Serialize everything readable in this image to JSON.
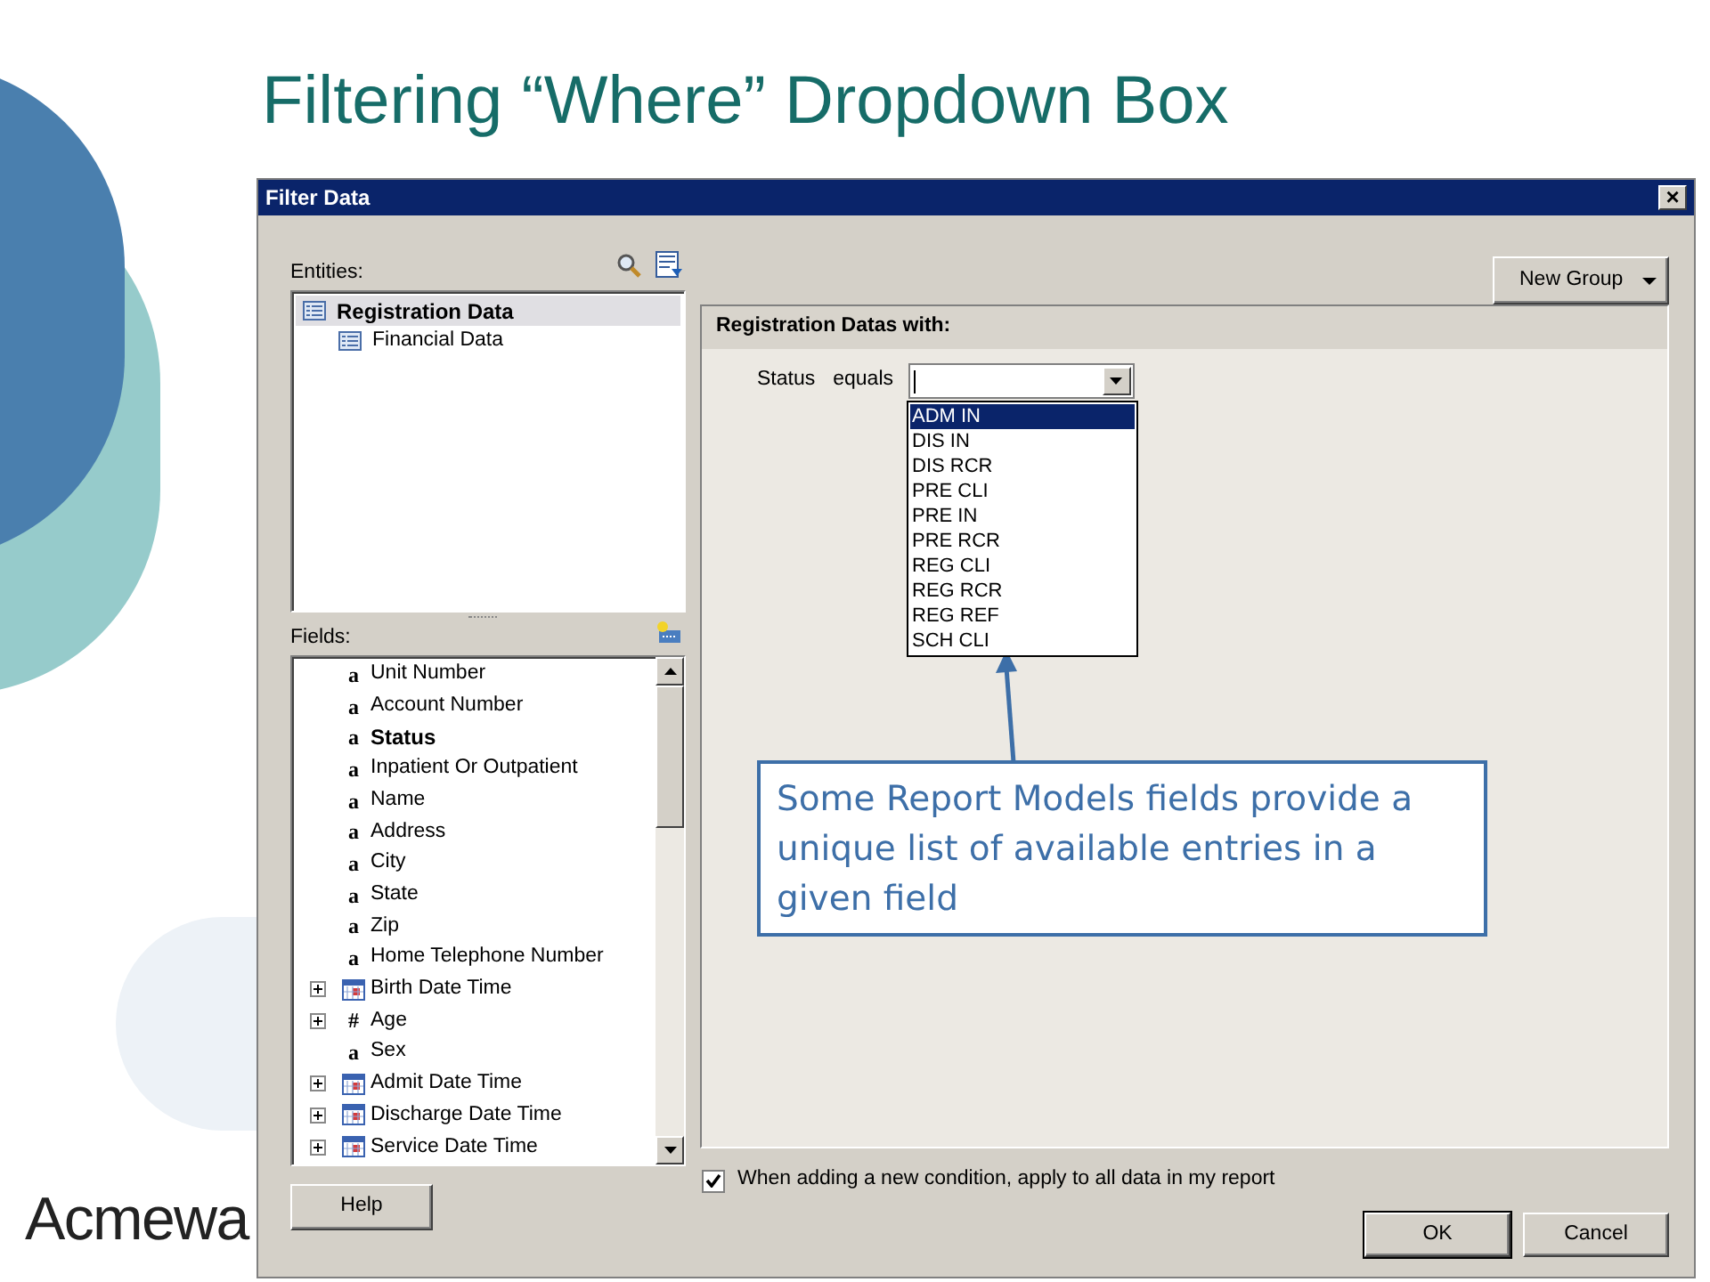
{
  "slide": {
    "title": "Filtering “Where” Dropdown Box",
    "logo_text": "Acmewa"
  },
  "window": {
    "title": "Filter Data",
    "close": "×"
  },
  "entities": {
    "label": "Entities:",
    "items": [
      {
        "label": "Registration Data",
        "selected": true
      },
      {
        "label": "Financial Data",
        "selected": false
      }
    ]
  },
  "fields": {
    "label": "Fields:",
    "items": [
      {
        "label": "Unit Number",
        "kind": "text",
        "glyph": "a",
        "selected": false,
        "expandable": false
      },
      {
        "label": "Account Number",
        "kind": "text",
        "glyph": "a",
        "selected": false,
        "expandable": false
      },
      {
        "label": "Status",
        "kind": "text",
        "glyph": "a",
        "selected": true,
        "expandable": false
      },
      {
        "label": "Inpatient Or Outpatient",
        "kind": "text",
        "glyph": "a",
        "selected": false,
        "expandable": false
      },
      {
        "label": "Name",
        "kind": "text",
        "glyph": "a",
        "selected": false,
        "expandable": false
      },
      {
        "label": "Address",
        "kind": "text",
        "glyph": "a",
        "selected": false,
        "expandable": false
      },
      {
        "label": "City",
        "kind": "text",
        "glyph": "a",
        "selected": false,
        "expandable": false
      },
      {
        "label": "State",
        "kind": "text",
        "glyph": "a",
        "selected": false,
        "expandable": false
      },
      {
        "label": "Zip",
        "kind": "text",
        "glyph": "a",
        "selected": false,
        "expandable": false
      },
      {
        "label": "Home Telephone Number",
        "kind": "text",
        "glyph": "a",
        "selected": false,
        "expandable": false
      },
      {
        "label": "Birth Date Time",
        "kind": "date",
        "selected": false,
        "expandable": true
      },
      {
        "label": "Age",
        "kind": "number",
        "glyph": "#",
        "selected": false,
        "expandable": true
      },
      {
        "label": "Sex",
        "kind": "text",
        "glyph": "a",
        "selected": false,
        "expandable": false
      },
      {
        "label": "Admit Date Time",
        "kind": "date",
        "selected": false,
        "expandable": true
      },
      {
        "label": "Discharge Date Time",
        "kind": "date",
        "selected": false,
        "expandable": true
      },
      {
        "label": "Service Date Time",
        "kind": "date",
        "selected": false,
        "expandable": true
      }
    ]
  },
  "help_button": "Help",
  "new_group_button": "New Group",
  "filter_panel": {
    "header": "Registration Datas with:",
    "field": "Status",
    "operator": "equals",
    "options": [
      {
        "label": "ADM IN",
        "selected": true
      },
      {
        "label": "DIS IN",
        "selected": false
      },
      {
        "label": "DIS RCR",
        "selected": false
      },
      {
        "label": "PRE CLI",
        "selected": false
      },
      {
        "label": "PRE IN",
        "selected": false
      },
      {
        "label": "PRE RCR",
        "selected": false
      },
      {
        "label": "REG CLI",
        "selected": false
      },
      {
        "label": "REG RCR",
        "selected": false
      },
      {
        "label": "REG REF",
        "selected": false
      },
      {
        "label": "SCH CLI",
        "selected": false
      }
    ]
  },
  "callout": "Some Report Models fields provide a unique list of available entries in a given field",
  "apply_all": {
    "label": "When adding a new condition, apply to all data in my report",
    "checked": true
  },
  "buttons": [
    "OK",
    "Cancel"
  ]
}
